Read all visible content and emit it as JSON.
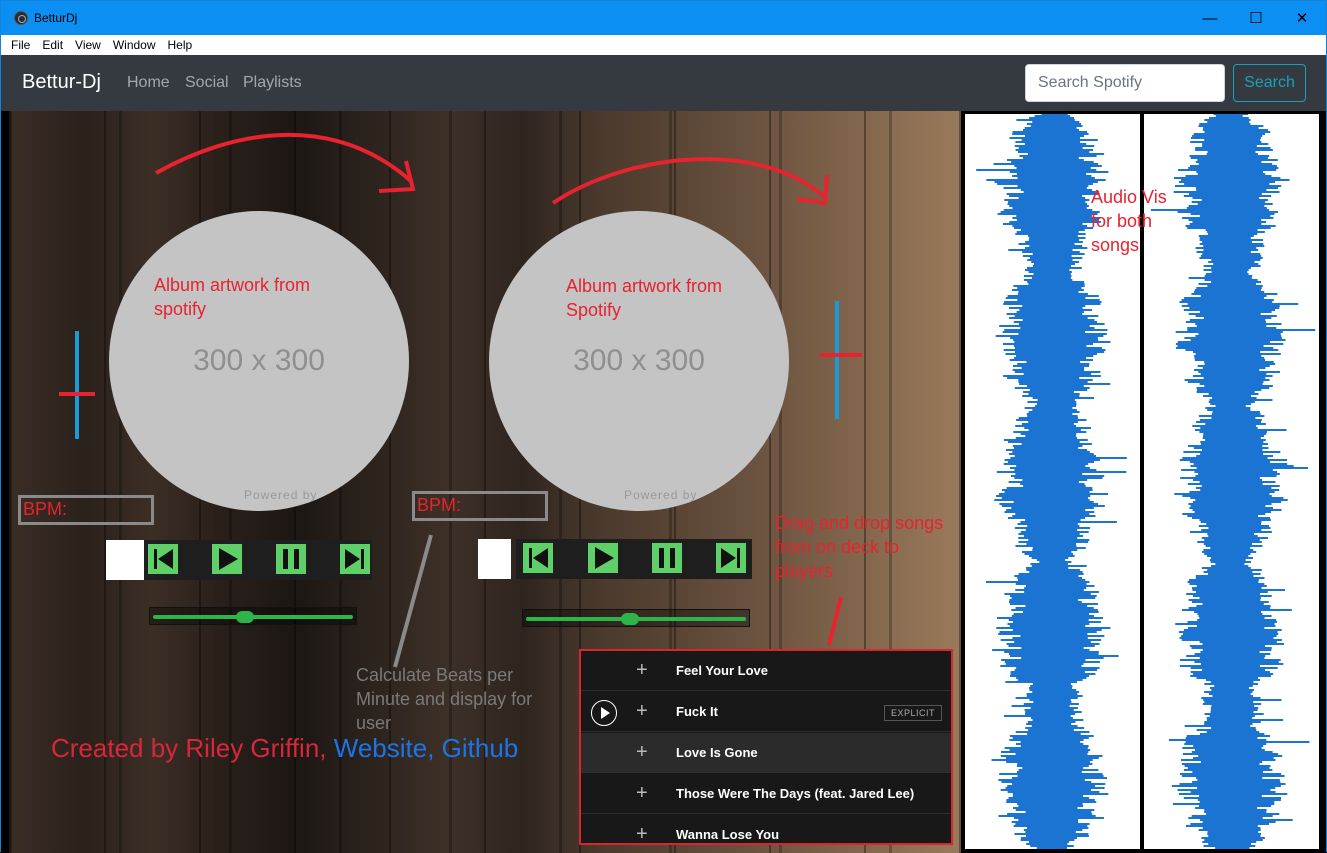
{
  "window": {
    "title": "BetturDj",
    "minimize": "—",
    "maximize": "☐",
    "close": "✕"
  },
  "menu": [
    "File",
    "Edit",
    "View",
    "Window",
    "Help"
  ],
  "navbar": {
    "brand": "Bettur-Dj",
    "links": [
      "Home",
      "Social",
      "Playlists"
    ],
    "search_placeholder": "Search Spotify",
    "search_button": "Search"
  },
  "decks": [
    {
      "art_placeholder": "300 x 300",
      "powered_by": "Powered by",
      "bpm_label": "BPM:",
      "art_note": "Album artwork from spotify"
    },
    {
      "art_placeholder": "300 x 300",
      "powered_by": "Powered by",
      "bpm_label": "BPM:",
      "art_note": "Album artwork from Spotify"
    }
  ],
  "annotations": {
    "bpm_note": "Calculate Beats per Minute and display for user",
    "drag_note": "Drag and drop songs from on deck to players",
    "vis_note": "Audio Vis for both songs"
  },
  "credit": {
    "prefix": "Created by Riley Griffin, ",
    "website": "Website",
    "sep": ", ",
    "github": "Github"
  },
  "tracks": [
    {
      "title": "Feel Your Love",
      "explicit": false
    },
    {
      "title": "Fuck It",
      "explicit": true,
      "explicit_label": "EXPLICIT"
    },
    {
      "title": "Love Is Gone",
      "explicit": false
    },
    {
      "title": "Those Were The Days (feat. Jared Lee)",
      "explicit": false
    },
    {
      "title": "Wanna Lose You",
      "explicit": false
    }
  ],
  "sliders": [
    {
      "value_fraction": 0.46
    },
    {
      "value_fraction": 0.47
    }
  ],
  "colors": {
    "accent_red": "#e8222e",
    "control_green": "#5fd068",
    "waveform_blue": "#1b74d2",
    "navbar": "#343a40",
    "titlebar": "#0b8ff2"
  }
}
